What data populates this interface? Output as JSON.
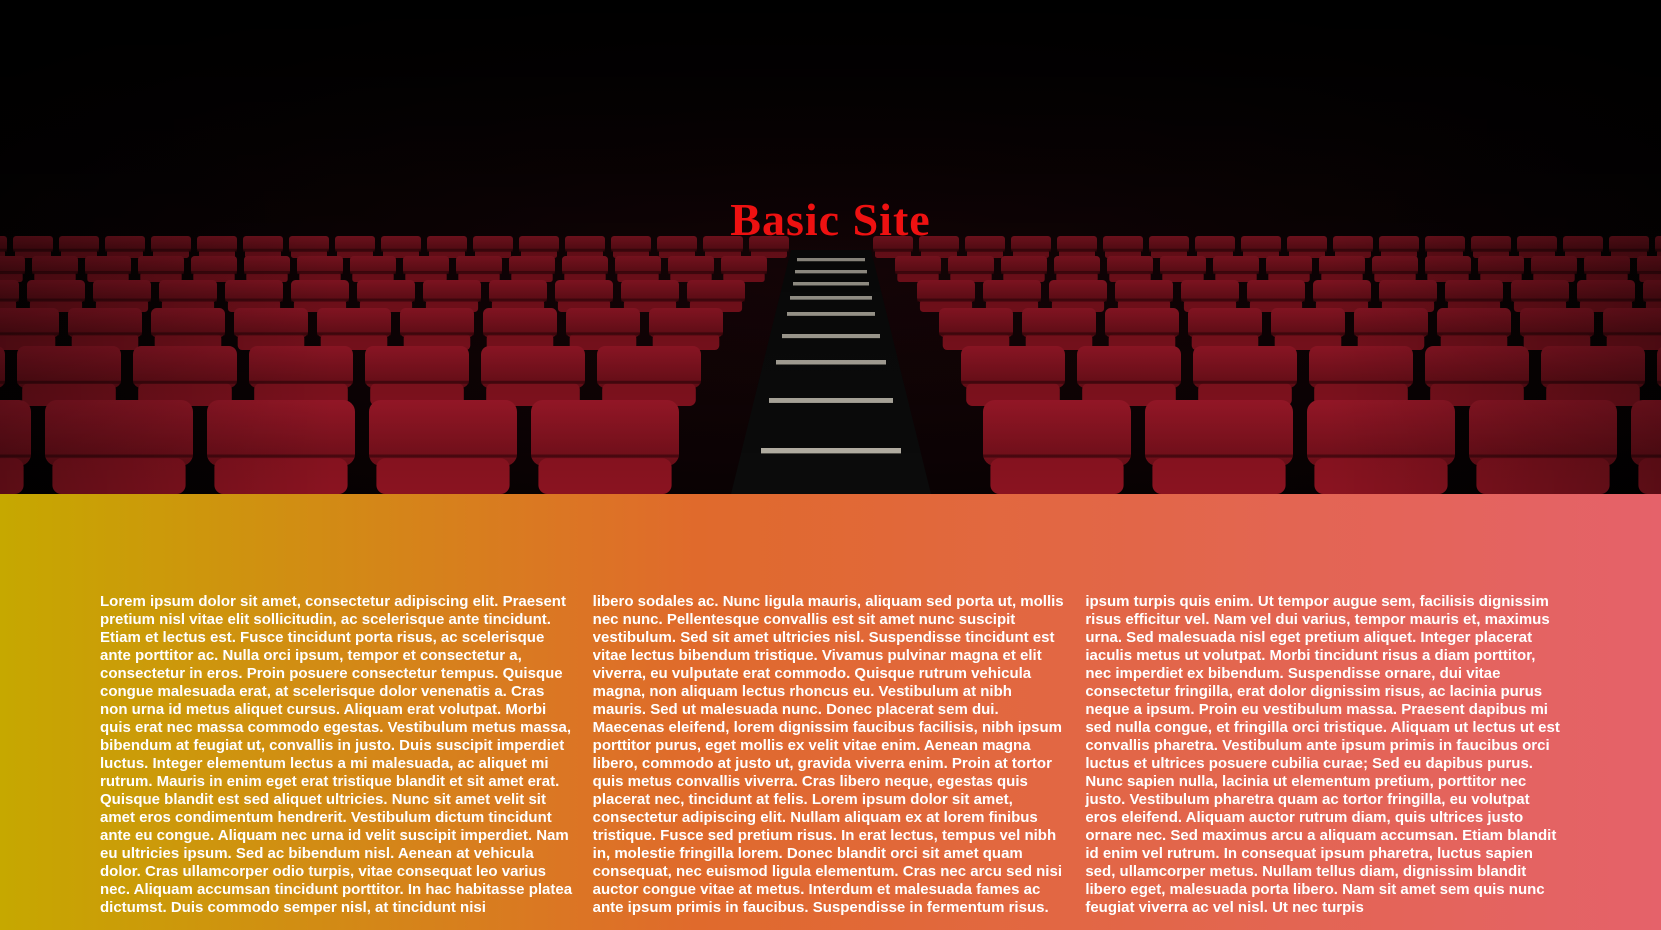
{
  "site": {
    "title": "Basic Site",
    "title_color": "#ee1111"
  },
  "theme": {
    "gradient_start": "#c6a800",
    "gradient_mid": "#e06a2c",
    "gradient_end": "#e5626a",
    "seat_color": "#8a1320"
  },
  "hero": {
    "image": "cinema-seats-with-lit-aisle-stairs"
  },
  "content": {
    "columns": [
      "Lorem ipsum dolor sit amet, consectetur adipiscing elit. Praesent pretium nisl vitae elit sollicitudin, ac scelerisque ante tincidunt. Etiam et lectus est. Fusce tincidunt porta risus, ac scelerisque ante porttitor ac. Nulla orci ipsum, tempor et consectetur a, consectetur in eros. Proin posuere consectetur tempus. Quisque congue malesuada erat, at scelerisque dolor venenatis a. Cras non urna id metus aliquet cursus. Aliquam erat volutpat. Morbi quis erat nec massa commodo egestas. Vestibulum metus massa, bibendum at feugiat ut, convallis in justo. Duis suscipit imperdiet luctus. Integer elementum lectus a mi malesuada, ac aliquet mi rutrum. Mauris in enim eget erat tristique blandit et sit amet erat. Quisque blandit est sed aliquet ultricies. Nunc sit amet velit sit amet eros condimentum hendrerit. Vestibulum dictum tincidunt ante eu congue. Aliquam nec urna id velit suscipit imperdiet. Nam eu ultricies ipsum. Sed ac bibendum nisl. Aenean at vehicula dolor. Cras ullamcorper odio turpis, vitae consequat leo varius nec. Aliquam accumsan tincidunt porttitor. In hac habitasse platea dictumst. Duis commodo semper nisl, at tincidunt nisi",
      "libero sodales ac. Nunc ligula mauris, aliquam sed porta ut, mollis nec nunc. Pellentesque convallis est sit amet nunc suscipit vestibulum. Sed sit amet ultricies nisl. Suspendisse tincidunt est vitae lectus bibendum tristique. Vivamus pulvinar magna et elit viverra, eu vulputate erat commodo. Quisque rutrum vehicula magna, non aliquam lectus rhoncus eu. Vestibulum at nibh mauris. Sed ut malesuada nunc. Donec placerat sem dui. Maecenas eleifend, lorem dignissim faucibus facilisis, nibh ipsum porttitor purus, eget mollis ex velit vitae enim. Aenean magna libero, commodo at justo ut, gravida viverra enim. Proin at tortor quis metus convallis viverra. Cras libero neque, egestas quis placerat nec, tincidunt at felis. Lorem ipsum dolor sit amet, consectetur adipiscing elit. Nullam aliquam ex at lorem finibus tristique. Fusce sed pretium risus. In erat lectus, tempus vel nibh in, molestie fringilla lorem. Donec blandit orci sit amet quam consequat, nec euismod ligula elementum. Cras nec arcu sed nisi auctor congue vitae at metus. Interdum et malesuada fames ac ante ipsum primis in faucibus. Suspendisse in fermentum risus.",
      "ipsum turpis quis enim. Ut tempor augue sem, facilisis dignissim risus efficitur vel. Nam vel dui varius, tempor mauris et, maximus urna. Sed malesuada nisl eget pretium aliquet. Integer placerat iaculis metus ut volutpat. Morbi tincidunt risus a diam porttitor, nec imperdiet ex bibendum. Suspendisse ornare, dui vitae consectetur fringilla, erat dolor dignissim risus, ac lacinia purus neque a ipsum. Proin eu vestibulum massa. Praesent dapibus mi sed nulla congue, et fringilla orci tristique. Aliquam ut lectus ut est convallis pharetra. Vestibulum ante ipsum primis in faucibus orci luctus et ultrices posuere cubilia curae; Sed eu dapibus purus. Nunc sapien nulla, lacinia ut elementum pretium, porttitor nec justo. Vestibulum pharetra quam ac tortor fringilla, eu volutpat eros eleifend. Aliquam auctor rutrum diam, quis ultrices justo ornare nec. Sed maximus arcu a aliquam accumsan. Etiam blandit id enim vel rutrum. In consequat ipsum pharetra, luctus sapien sed, ullamcorper metus. Nullam tellus diam, dignissim blandit libero eget, malesuada porta libero. Nam sit amet sem quis nunc feugiat viverra ac vel nisl. Ut nec turpis"
    ]
  }
}
